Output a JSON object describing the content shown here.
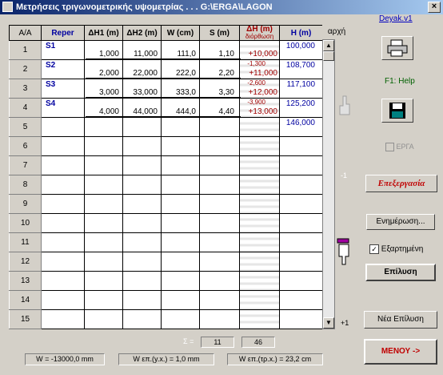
{
  "window": {
    "title": "Μετρήσεις τριγωνομετρικής υψομετρίας . . . G:\\ERGA\\LAGON",
    "close": "×"
  },
  "columns": {
    "aa": "Α/Α",
    "reper": "Reper",
    "dh1": "ΔΗ1 (m)",
    "dh2": "ΔΗ2 (m)",
    "w": "W (cm)",
    "s": "S (m)",
    "dh": "ΔΗ (m)",
    "dh_sub": "διόρθωση",
    "h": "Η (m)",
    "archi": "αρχή"
  },
  "row_numbers": [
    "1",
    "2",
    "3",
    "4",
    "5",
    "6",
    "7",
    "8",
    "9",
    "10",
    "11",
    "12",
    "13",
    "14",
    "15"
  ],
  "repers": [
    "S1",
    "S2",
    "S3",
    "S4"
  ],
  "measurements": [
    {
      "dh1": "1,000",
      "dh2": "11,000",
      "w": "111,0",
      "s": "1,10"
    },
    {
      "dh1": "2,000",
      "dh2": "22,000",
      "w": "222,0",
      "s": "2,20"
    },
    {
      "dh1": "3,000",
      "dh2": "33,000",
      "w": "333,0",
      "s": "3,30"
    },
    {
      "dh1": "4,000",
      "dh2": "44,000",
      "w": "444,0",
      "s": "4,40"
    }
  ],
  "dh_values": [
    {
      "correction": "",
      "value": "+10,000"
    },
    {
      "correction": "-1,300",
      "value": "+11,000"
    },
    {
      "correction": "-2,600",
      "value": "+12,000"
    },
    {
      "correction": "-3,900",
      "value": "+13,000"
    }
  ],
  "h_values": [
    "100,000",
    "108,700",
    "117,100",
    "125,200",
    "146,000"
  ],
  "scroll": {
    "up": "▲",
    "down": "▼",
    "tick_mid": "-1",
    "tick_bottom": "+1"
  },
  "sidebar": {
    "link": "Deyak.v1",
    "help": "F1: Help",
    "erga_checkbox": "ΕΡΓΑ",
    "processing": "Επεξεργασία",
    "update_button": "Ενημέρωση...",
    "dependent_label": "Εξαρτημένη",
    "solve_button": "Επίλυση",
    "new_solve_button": "Νέα Επίλυση",
    "menu_button": "ΜΕΝΟΥ ->"
  },
  "sums": {
    "label": "Σ =",
    "a": "11",
    "b": "46"
  },
  "status": {
    "w": "W = -13000,0 mm",
    "w_yx": "W επ.(y.x.) = 1,0 mm",
    "w_trx": "W επ.(τρ.x.) = 23,2 cm"
  },
  "colors": {
    "title_start": "#0a246a",
    "title_end": "#a6caf0",
    "dark_red": "#a00000",
    "blue": "#0000a0",
    "green": "#006000"
  }
}
